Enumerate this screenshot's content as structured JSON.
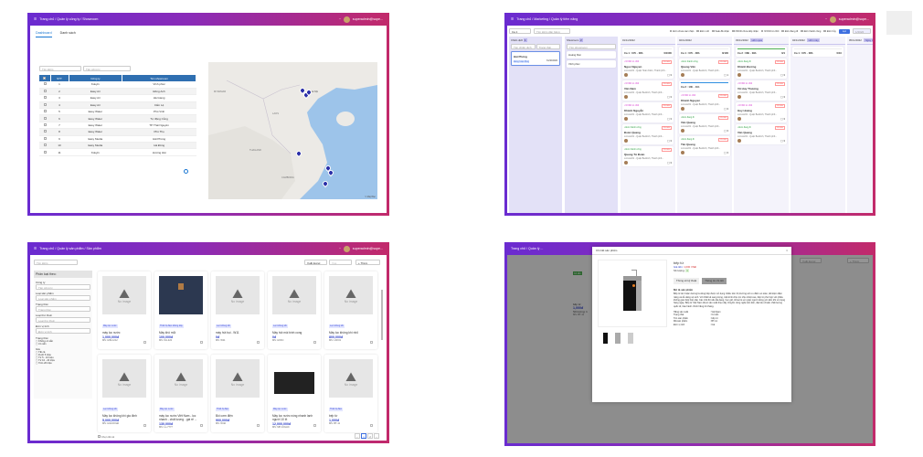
{
  "p1": {
    "breadcrumb": "Trang chủ / Quản lý công ty / Showroom",
    "user": "superadmin@supe...",
    "tabs": [
      "Dashboard",
      "Danh sách"
    ],
    "search_placeholder": "Tìm kiếm",
    "company_placeholder": "Tên công ty",
    "headers": [
      "STT",
      "Công ty",
      "Tên showroom"
    ],
    "rows": [
      [
        "1",
        "Kokyi1",
        "Vĩnh phúc"
      ],
      [
        "2",
        "Easy Air",
        "Đông Anh"
      ],
      [
        "3",
        "Easy Air",
        "Hà Giang"
      ],
      [
        "4",
        "Easy Air",
        "Cẩm Lệ"
      ],
      [
        "5",
        "Easy Water",
        "Phú Vinh"
      ],
      [
        "6",
        "Easy Water",
        "Tự động Củng"
      ],
      [
        "7",
        "Easy Water",
        "TP Thái Nguyên"
      ],
      [
        "8",
        "Easy Water",
        "Phú Thọ"
      ],
      [
        "9",
        "Easy Media",
        "Hải Phòng"
      ],
      [
        "10",
        "Easy Media",
        "Hà Đông"
      ],
      [
        "11",
        "Kokyi1",
        "Hương Hải"
      ]
    ],
    "map_labels": [
      "MYANMAR",
      "LAOS",
      "THAILAND",
      "CAMBODIA",
      "Hà Nội"
    ],
    "map_credit": "© MapTiler"
  },
  "p2": {
    "breadcrumb": "Trang chủ / Marketing / Quản lý tiêm năng",
    "user": "superadmin@supe...",
    "shift": "Ca 1",
    "search_placeholder": "Tìm kiếm dân bảng",
    "filters": [
      "Đơn chưa xác nhận",
      "Đơn mới",
      "Sale đã nhận",
      "NVKD chưa tiếp nhận",
      "NVKD từ chối",
      "Đơn đang đi",
      "Đơn thành công",
      "Đơn hủy"
    ],
    "filter_button": "Lọc",
    "date_range": "1/2022",
    "campaign_col": {
      "title": "Chiến dịch",
      "count": "1",
      "search": "Tên chiến dịch",
      "status": "Trạng thái",
      "card_title": "Hải Phòng",
      "card_tag": "Đang hoạt động",
      "card_date": "31/10/2022"
    },
    "showroom_col": {
      "title": "Showroom",
      "count": "2",
      "search": "Tìm showroom",
      "items": [
        "Hoàng Mai",
        "Vĩnh phúc"
      ]
    },
    "days": [
      {
        "date": "01/11/2022",
        "badge": "",
        "shift": "Ca 1 : 07h - 08h",
        "count": "0/1000",
        "cards": [
          {
            "status": "NVKD từ chối",
            "name": "Ngọc Nguyen",
            "addr": "xxxxxx221 - Quận Hoàn Kiếm, Thành phố...",
            "n": "3"
          },
          {
            "status": "NVKD từ chối",
            "name": "Văn Nam",
            "addr": "xxxxxx221 - Quận Ba Đình, Thành phố...",
            "n": "3"
          },
          {
            "status": "NVKD từ chối",
            "name": "Khánh Nguyễn",
            "addr": "xxxxxx221 - Quận Ba Đình, Thành phố...",
            "n": "3"
          },
          {
            "status": "Đơn thành công",
            "name": "Đoàn Quang",
            "addr": "xxxxxx221 - Quận Ba Đình, Thành phố...",
            "n": "3"
          },
          {
            "status": "Đơn thành công",
            "name": "Quang Tú Đoàn",
            "addr": "xxxxxx221 - Quận Ba Đình, Thành phố...",
            "n": "3"
          }
        ]
      },
      {
        "date": "02/11/2022",
        "badge": "",
        "shift": "Ca 1 : 07h - 08h",
        "count": "0/100",
        "cards": [
          {
            "status": "Đơn thành công",
            "name": "Quang Văn",
            "addr": "xxxxxx221 - Quận Ba Đình, Thành phố...",
            "n": "1"
          },
          {
            "status": "NVKD từ chối",
            "name": "Khánh Nguyen",
            "addr": "xxxxxx221 - Quận Ba Đình, Thành phố...",
            "n": "3"
          },
          {
            "status": "Đơn đang đi",
            "name": "Văn Quang",
            "addr": "xxxxxx221 - Quận Ba Đình, Thành phố...",
            "n": "3"
          },
          {
            "status": "Đơn đang đi",
            "name": "Tân Quang",
            "addr": "xxxxxx221 - Quận Ba Đình, Thành phố...",
            "n": "3"
          }
        ]
      },
      {
        "date": "03/11/2022",
        "badge": "Hôm qua",
        "shift": "Ca 2 : 08h - 09h",
        "count": "0/1",
        "cards": [
          {
            "status": "Đơn đang đi",
            "name": "Khánh Đương",
            "addr": "xxxxxx221 - Quận Ba Đình, Thành phố...",
            "n": "3"
          },
          {
            "status": "NVKD từ chối",
            "name": "Vũ Huy Thượng",
            "addr": "xxxxxx221 - Quận Ba Đình, Thành phố...",
            "n": "3"
          },
          {
            "status": "NVKD từ chối",
            "name": "Huy Hoàng",
            "addr": "xxxxxx221 - Quận Ba Đình, Thành phố...",
            "n": "3"
          },
          {
            "status": "Đơn đang đi",
            "name": "Văn Quang",
            "addr": "xxxxxx221 - Quận Ba Đình, Thành phố...",
            "n": "3"
          }
        ]
      },
      {
        "date": "04/11/2022",
        "badge": "Hôm nay",
        "shift": "Ca 1 : 07h - 08h",
        "count": "0/10",
        "cards": []
      },
      {
        "date": "05/11/2022",
        "badge": "Ngày mai",
        "shift": "",
        "count": "",
        "cards": []
      }
    ]
  },
  "p3": {
    "breadcrumb": "Trang chủ / Quản lý sản phẩm / Sản phẩm",
    "user": "superadmin@supe...",
    "search_placeholder": "Tìm kiếm",
    "buttons": {
      "export": "Xuất Excel",
      "delete": "Xóa",
      "add": "+ Thêm"
    },
    "filter": {
      "title": "Phân loại theo:",
      "groups": [
        {
          "label": "Công ty",
          "ph": "Tên công ty"
        },
        {
          "label": "Loại sản phẩm",
          "ph": "Loại sản phẩm"
        },
        {
          "label": "Trạng thái",
          "ph": "Trạng thái"
        },
        {
          "label": "Loại thư thuế",
          "ph": "Loại thư thuế"
        },
        {
          "label": "Đơn vị tính",
          "ph": "Đơn vị tính"
        }
      ],
      "status_label": "Trạng thái",
      "status_opts": [
        "Không có sẵn",
        "Có sẵn"
      ],
      "price_label": "Giá",
      "price_opts": [
        "Tất cả",
        "Dưới 5 triệu",
        "Từ 5 - 10 triệu",
        "Từ 10 - 20 triệu",
        "Trên 20 triệu"
      ]
    },
    "no_image": "No image",
    "select_all": "Chọn tất cả",
    "pages": [
      "‹",
      "1",
      "2",
      "›"
    ],
    "products": [
      {
        "badge": "Máy lọc nước",
        "name": "máy lọc nước",
        "price": "1,000,000đ",
        "ms": "MS: H99-1212",
        "img": "none"
      },
      {
        "badge": "Thiết bị điện không dây",
        "name": "Máy khô mũi",
        "price": "100,000đ",
        "ms": "MS: KH-222",
        "img": "bag"
      },
      {
        "badge": "Lọc không khí",
        "name": "máy hút bụi - W11",
        "price": "0đ",
        "ms": "MS: W11",
        "img": "none"
      },
      {
        "badge": "Lọc không khí",
        "name": "Máy hút mùi bình cong",
        "price": "0đ",
        "ms": "MS: HKKC",
        "img": "none"
      },
      {
        "badge": "Lọc không khí",
        "name": "Máy lọc không khí nhỏ",
        "price": "800,000đ",
        "ms": "MS: LKK01",
        "img": "none"
      },
      {
        "badge": "Lọc không khí",
        "name": "Máy lọc không khí gia đình",
        "price": "5,000,000đ",
        "ms": "MS: HGLKKGĐ",
        "img": "none"
      },
      {
        "badge": "Máy lọc nước",
        "name": "máy lọc nước Việt Nam - lọc nhanh - chất lượng - giá rẻ ...",
        "price": "130,000đ",
        "ms": "MS: LL-7777",
        "img": "none"
      },
      {
        "badge": "Thiết bị điện",
        "name": "Bồi cơm điện",
        "price": "900,000đ",
        "ms": "MS: NCĐ",
        "img": "none"
      },
      {
        "badge": "Máy lọc nước",
        "name": "Máy lọc nước nóng nhanh lạnh người 10 lít",
        "price": "12,000,000đ",
        "ms": "MS: MP-10GHC",
        "img": "dark"
      },
      {
        "badge": "Thiết bị điện",
        "name": "bếp từ",
        "price": "1,000đ",
        "ms": "MS: BT-11",
        "img": "none"
      }
    ]
  },
  "p4": {
    "breadcrumb": "Trang chủ / Quản lý ...",
    "modal_title": "Chi tiết sản phẩm",
    "product_name": "bếp từ",
    "price_label": "Giá tiền:",
    "price": "1,000 VNĐ",
    "qty_label": "Số lượng:",
    "qty": "1",
    "tab_specs": "Thông số kỹ thuật",
    "tab_detail": "Thông tin chi tiết",
    "desc_title": "Mô tả sản phẩm",
    "desc": "Bếp từ âm hoặc dương là dòng bếp được sử dụng nhiều trên thị trường với ưu điểm an toàn, tiết kiệm điện năng và dễ dàng vệ sinh. Với thiết kế sang trọng, mặt kính chịu lực chịu nhiệt cao, bếp từ phù hợp với nhiều không gian bếp hiện đại. Các chế độ nấu đa dạng, hẹn giờ, khóa trẻ em giúp người dùng yên tâm khi sử dụng hàng ngày. Bếp từ Việt Nam được sản xuất theo dây chuyền công nghệ tiên tiến, đạt tiêu chuẩn chất lượng quốc tế, bảo hành chính hãng 24 tháng.",
    "specs": [
      [
        "Hãng sản xuất",
        "Việt Nam"
      ],
      [
        "Trạng thái",
        "Có sẵn"
      ],
      [
        "Tên sản phẩm",
        "bếp từ"
      ],
      [
        "Mã sản phẩm",
        "BT-11"
      ],
      [
        "Đơn vị tính",
        "Cái"
      ]
    ],
    "bg_badge": "Có sẵn",
    "bg_name": "bếp từ",
    "bg_price": "1,000đ",
    "bg_qty": "Số lượng: 1",
    "bg_ms": "MS: BT-11",
    "bg_add": "+ Thêm",
    "bg_export": "Xuất Excel"
  }
}
